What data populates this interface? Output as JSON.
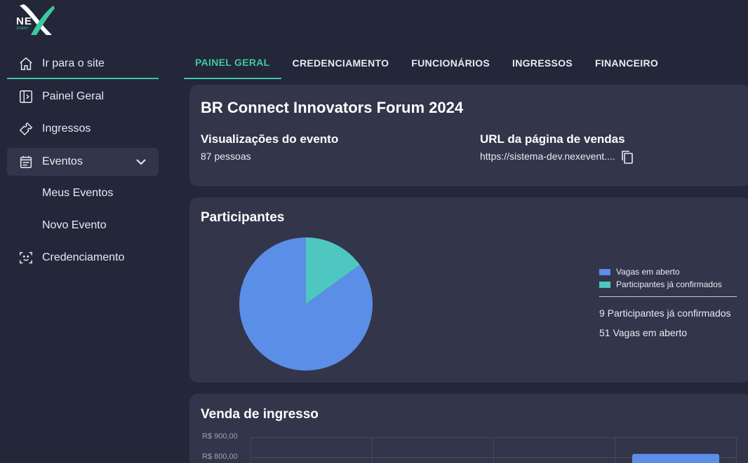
{
  "logo": {
    "text": "NE",
    "sub": "EVENT"
  },
  "sidebar": {
    "items": [
      {
        "label": "Ir para o site",
        "icon": "home-icon"
      },
      {
        "label": "Painel Geral",
        "icon": "panel-icon"
      },
      {
        "label": "Ingressos",
        "icon": "ticket-icon"
      },
      {
        "label": "Eventos",
        "icon": "calendar-icon"
      },
      {
        "label": "Credenciamento",
        "icon": "face-scan-icon"
      }
    ],
    "sub_items": [
      {
        "label": "Meus Eventos"
      },
      {
        "label": "Novo Evento"
      }
    ]
  },
  "tabs": [
    {
      "label": "PAINEL GERAL",
      "active": true
    },
    {
      "label": "CREDENCIAMENTO"
    },
    {
      "label": "FUNCIONÁRIOS"
    },
    {
      "label": "INGRESSOS"
    },
    {
      "label": "FINANCEIRO"
    }
  ],
  "event": {
    "title": "BR Connect Innovators Forum 2024",
    "views_label": "Visualizações do evento",
    "views_value": "87 pessoas",
    "url_label": "URL da página de vendas",
    "url_value": "https://sistema-dev.nexevent...."
  },
  "participants": {
    "title": "Participantes",
    "legend": [
      {
        "label": "Vagas em aberto",
        "color": "#5b8ee6"
      },
      {
        "label": "Participantes já confirmados",
        "color": "#4ec7c0"
      }
    ],
    "confirmed_text": "9 Participantes já confirmados",
    "open_text": "51 Vagas em aberto"
  },
  "chart_data": {
    "type": "pie",
    "categories": [
      "Vagas em aberto",
      "Participantes já confirmados"
    ],
    "values": [
      51,
      9
    ]
  },
  "sales": {
    "title": "Venda de ingresso",
    "y_ticks": [
      "R$ 900,00",
      "R$ 800,00"
    ]
  },
  "colors": {
    "accent": "#3ec8a0",
    "background": "#24263a",
    "card": "#33354b"
  }
}
